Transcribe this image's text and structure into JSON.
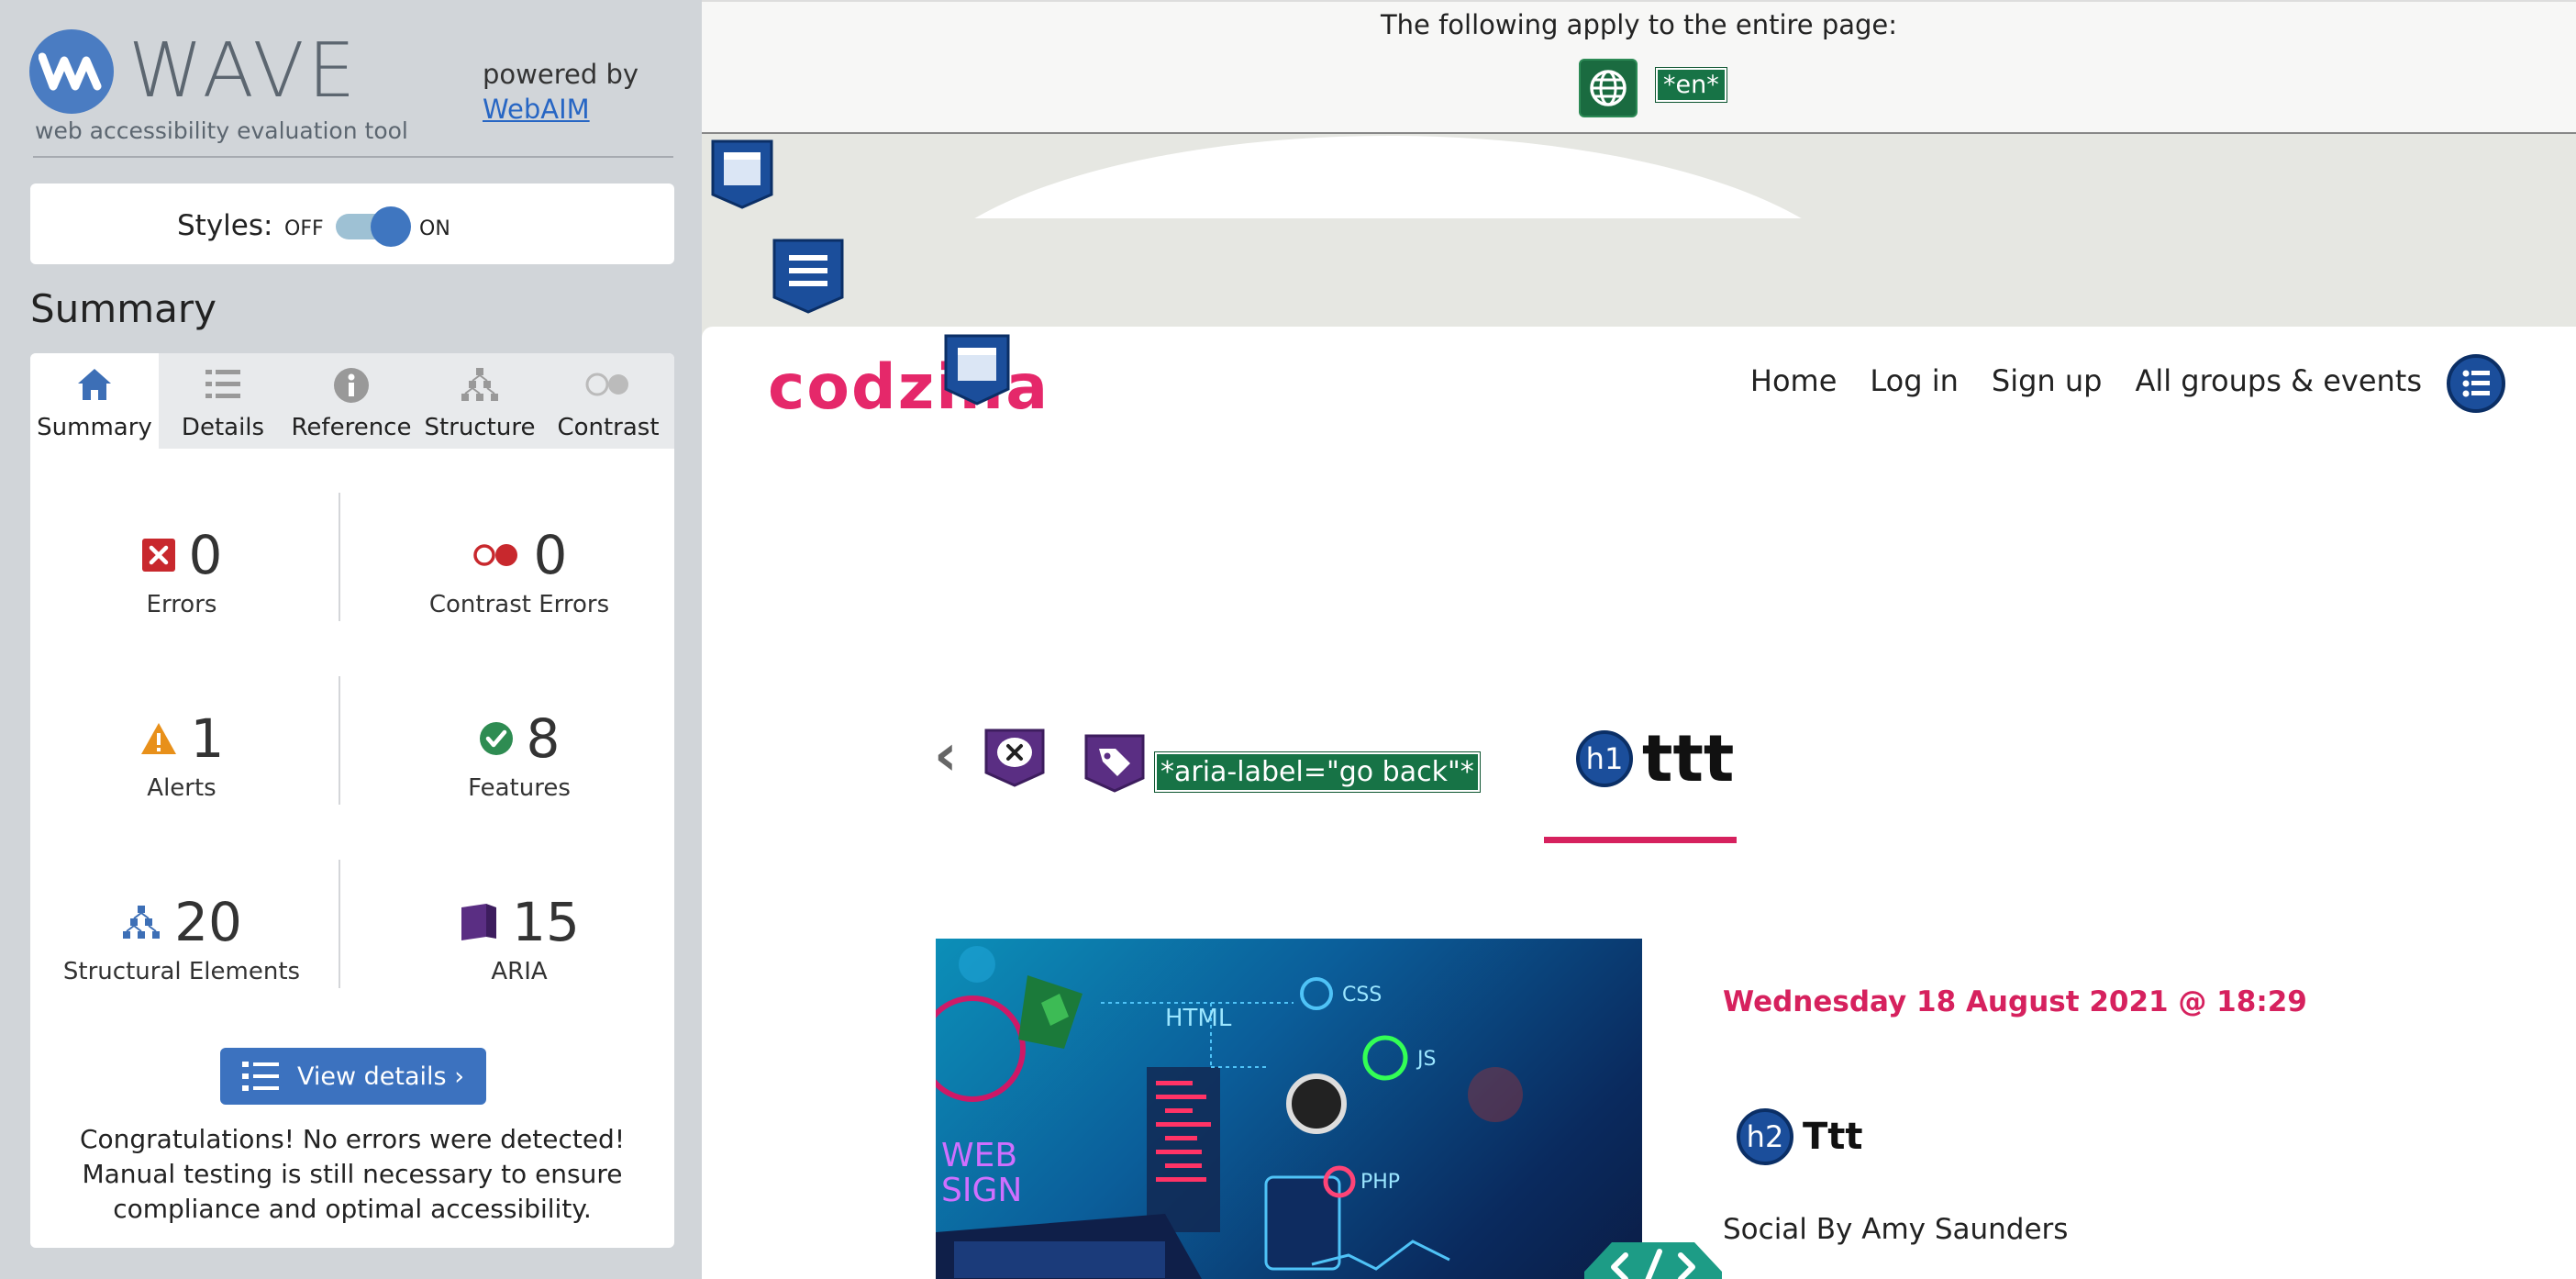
{
  "wave": {
    "logo_word": "WAVE",
    "logo_sub": "web accessibility evaluation tool",
    "powered_by": "powered by",
    "powered_link": "WebAIM",
    "styles_label": "Styles:",
    "styles_off": "OFF",
    "styles_on": "ON",
    "summary_heading": "Summary",
    "tabs": [
      {
        "label": "Summary",
        "icon": "home-icon",
        "active": true
      },
      {
        "label": "Details",
        "icon": "list-icon",
        "active": false
      },
      {
        "label": "Reference",
        "icon": "info-icon",
        "active": false
      },
      {
        "label": "Structure",
        "icon": "structure-icon",
        "active": false
      },
      {
        "label": "Contrast",
        "icon": "contrast-icon",
        "active": false
      }
    ],
    "stats": {
      "errors": {
        "value": "0",
        "label": "Errors"
      },
      "contrast_errors": {
        "value": "0",
        "label": "Contrast Errors"
      },
      "alerts": {
        "value": "1",
        "label": "Alerts"
      },
      "features": {
        "value": "8",
        "label": "Features"
      },
      "structural": {
        "value": "20",
        "label": "Structural Elements"
      },
      "aria": {
        "value": "15",
        "label": "ARIA"
      }
    },
    "view_details": "View details ›",
    "congrats": "Congratulations! No errors were detected! Manual testing is still necessary to ensure compliance and optimal accessibility."
  },
  "page": {
    "top_note": "The following apply to the entire page:",
    "lang_tag": "*en*",
    "brand": "codzilla",
    "nav": [
      "Home",
      "Log in",
      "Sign up",
      "All groups & events"
    ],
    "aria_label_tag": "*aria-label=\"go back\"*",
    "h1_badge": "h1",
    "h1": "ttt",
    "date": "Wednesday 18 August 2021 @ 18:29",
    "h2_badge": "h2",
    "h2": "Ttt",
    "social": "Social By Amy Saunders",
    "hero_words": {
      "html": "HTML",
      "css": "CSS",
      "js": "JS",
      "php": "PHP",
      "web": "WEB",
      "sign": "SIGN"
    }
  },
  "colors": {
    "wave_blue": "#3c72bf",
    "error_red": "#c8282d",
    "alert_orange": "#e8901a",
    "feature_green": "#2e8c52",
    "aria_purple": "#5a2e83",
    "brand_pink": "#e5286a",
    "wave_green_tag": "#177346"
  }
}
